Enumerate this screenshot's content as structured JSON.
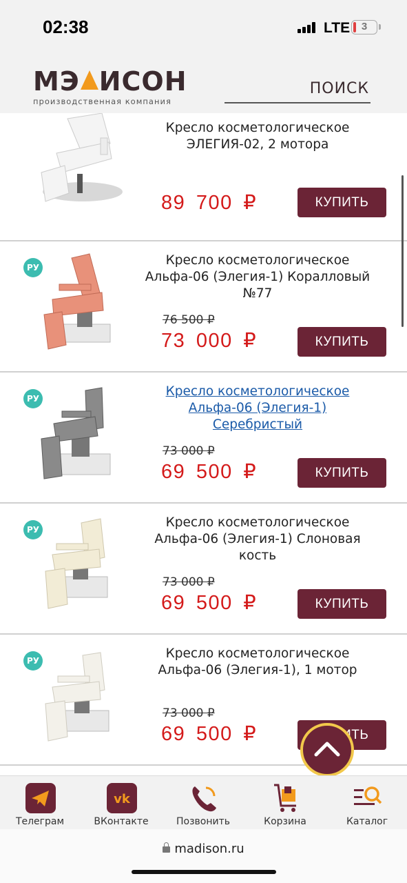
{
  "status_bar": {
    "time": "02:38",
    "network": "LTE",
    "battery": "3"
  },
  "header": {
    "logo_left": "МЭ",
    "logo_right": "ИСОН",
    "logo_sub": "производственная компания",
    "search_label": "ПОИСК"
  },
  "products": [
    {
      "title": "Кресло косметологическое ЭЛЕГИЯ-02, 2 мотора",
      "old_price": "",
      "price": "89 700 ₽",
      "buy_label": "КУПИТЬ",
      "badge": "",
      "color": "#f4f4f4"
    },
    {
      "title": "Кресло косметологическое Альфа-06 (Элегия-1) Коралловый №77",
      "old_price": "76 500 ₽",
      "price": "73 000 ₽",
      "buy_label": "КУПИТЬ",
      "badge": "РУ",
      "color": "#e8917a"
    },
    {
      "title": "Кресло косметологическое Альфа-06 (Элегия-1) Серебристый",
      "old_price": "73 000 ₽",
      "price": "69 500 ₽",
      "buy_label": "КУПИТЬ",
      "badge": "РУ",
      "color": "#8a8a8a"
    },
    {
      "title": "Кресло косметологическое Альфа-06 (Элегия-1) Слоновая кость",
      "old_price": "73 000 ₽",
      "price": "69 500 ₽",
      "buy_label": "КУПИТЬ",
      "badge": "РУ",
      "color": "#f2ecd6"
    },
    {
      "title": "Кресло косметологическое Альфа-06 (Элегия-1), 1 мотор",
      "old_price": "73 000 ₽",
      "price": "69 500 ₽",
      "buy_label": "КУПИТЬ",
      "badge": "РУ",
      "color": "#f3f1ea"
    }
  ],
  "bottom_nav": [
    {
      "label": "Телеграм",
      "icon": "telegram-icon"
    },
    {
      "label": "ВКонтакте",
      "icon": "vk-icon"
    },
    {
      "label": "Позвонить",
      "icon": "phone-icon"
    },
    {
      "label": "Корзина",
      "icon": "cart-icon"
    },
    {
      "label": "Каталог",
      "icon": "catalog-icon"
    }
  ],
  "url_bar": {
    "url": "madison.ru"
  },
  "colors": {
    "brand": "#6b2436",
    "price": "#d41a1a",
    "accent": "#f29a1d",
    "badge": "#3cbcb0"
  }
}
